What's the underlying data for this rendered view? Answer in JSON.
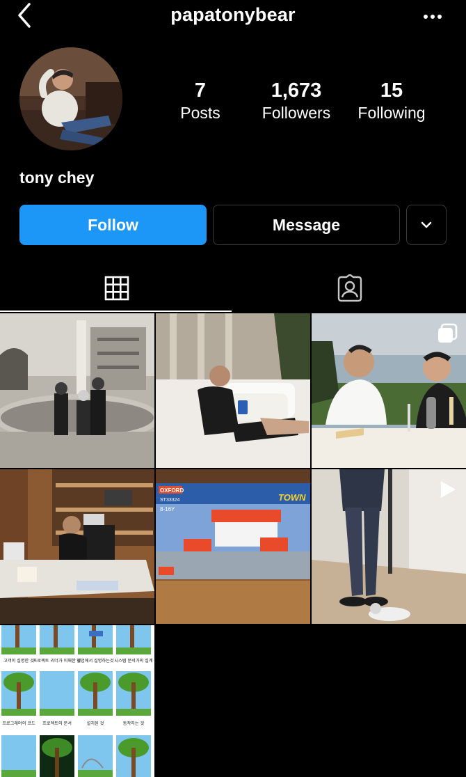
{
  "header": {
    "username": "papatonybear",
    "back_icon": "chevron-left-icon",
    "more_icon": "ellipsis-icon"
  },
  "profile": {
    "display_name": "tony chey",
    "stats": [
      {
        "value": "7",
        "label": "Posts"
      },
      {
        "value": "1,673",
        "label": "Followers"
      },
      {
        "value": "15",
        "label": "Following"
      }
    ]
  },
  "actions": {
    "follow_label": "Follow",
    "message_label": "Message",
    "more_icon": "chevron-down-icon"
  },
  "tabs": [
    {
      "icon": "grid-icon",
      "active": true
    },
    {
      "icon": "tagged-user-icon",
      "active": false
    }
  ],
  "colors": {
    "background": "#000000",
    "follow_button": "#1c96f7",
    "button_border": "#3a3a3a"
  },
  "posts": [
    {
      "subject": "vintage black-and-white family photo",
      "overlay_icon": null
    },
    {
      "subject": "man relaxing on white sofa with phone",
      "overlay_icon": null
    },
    {
      "subject": "two men at dinner table with wine",
      "overlay_icon": "carousel-icon"
    },
    {
      "subject": "man working at office desk",
      "overlay_icon": null
    },
    {
      "subject": "toy building set box",
      "overlay_icon": null,
      "box_brand": "OXFORD",
      "box_code": "ST33324",
      "box_title": "TOWN",
      "box_age": "8-16Y"
    },
    {
      "subject": "man standing with cat",
      "overlay_icon": "reel-icon"
    },
    {
      "subject": "tree swing comic",
      "overlay_icon": null,
      "captions": [
        "고객이 설명한 것",
        "프로젝트 리더가 이해한 것",
        "영업에서 설명하는것",
        "시스템 분석가의 설계",
        "프로그래머의 코드",
        "프로젝트의 문서",
        "설치된 것",
        "동작하는 것"
      ]
    }
  ]
}
